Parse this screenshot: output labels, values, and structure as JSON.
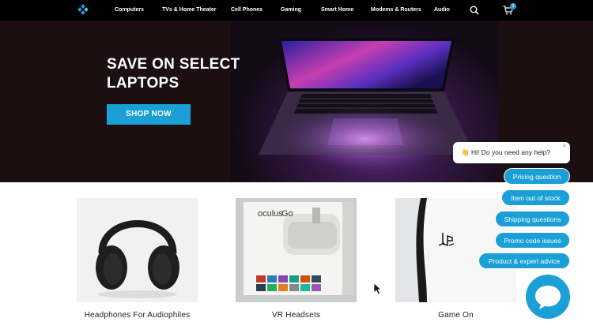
{
  "nav": {
    "items": [
      "Computers",
      "TVs & Home Theater",
      "Cell Phones",
      "Gaming",
      "Smart Home",
      "Modems & Routers",
      "Audio"
    ],
    "search_icon": "search-icon",
    "cart_icon": "cart-icon",
    "cart_count": "1"
  },
  "hero": {
    "title": "SAVE ON SELECT LAPTOPS",
    "button": "SHOP NOW"
  },
  "products": [
    {
      "caption": "Headphones For Audiophiles"
    },
    {
      "caption": "VR Headsets"
    },
    {
      "caption": "Game On"
    }
  ],
  "chat": {
    "greeting": "👋 Hi! Do you need any help?",
    "close": "×",
    "quick_replies": [
      "Pricing question",
      "Item out of stock",
      "Shipping questions",
      "Promo code issues",
      "Product & expert advice"
    ]
  },
  "vr_box": {
    "brand": "oculus",
    "model": "Go"
  },
  "colors": {
    "accent": "#1a9fd6",
    "nav_bg": "#000000",
    "hero_bg": "#1b0f12"
  }
}
